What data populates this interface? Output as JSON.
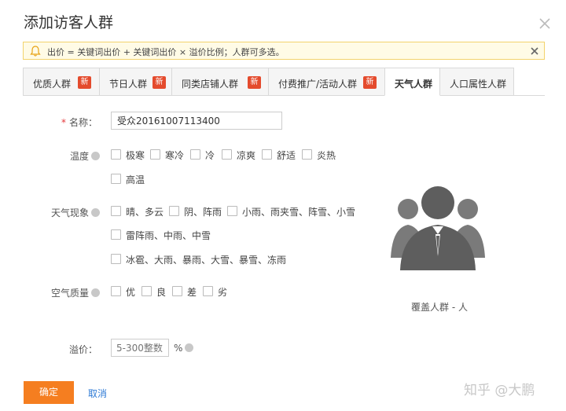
{
  "dialog": {
    "title": "添加访客人群"
  },
  "notice": {
    "text": "出价 = 关键词出价 + 关键词出价 × 溢价比例；人群可多选。"
  },
  "tabs": [
    {
      "label": "优质人群",
      "badge": "新",
      "active": false
    },
    {
      "label": "节日人群",
      "badge": "新",
      "active": false
    },
    {
      "label": "同类店铺人群",
      "badge": "新",
      "active": false
    },
    {
      "label": "付费推广/活动人群",
      "badge": "新",
      "active": false
    },
    {
      "label": "天气人群",
      "badge": "",
      "active": true
    },
    {
      "label": "人口属性人群",
      "badge": "",
      "active": false
    }
  ],
  "form": {
    "name": {
      "required_mark": "*",
      "label": "名称：",
      "value": "受众20161007113400"
    },
    "temperature": {
      "label": "温度",
      "options": [
        "极寒",
        "寒冷",
        "冷",
        "凉爽",
        "舒适",
        "炎热",
        "高温"
      ]
    },
    "weather": {
      "label": "天气现象",
      "options": [
        "晴、多云",
        "阴、阵雨",
        "小雨、雨夹雪、阵雪、小雪",
        "雷阵雨、中雨、中雪",
        "冰雹、大雨、暴雨、大雪、暴雪、冻雨"
      ]
    },
    "air_quality": {
      "label": "空气质量",
      "options": [
        "优",
        "良",
        "差",
        "劣"
      ]
    },
    "premium": {
      "label": "溢价：",
      "placeholder": "5-300整数",
      "unit": "%"
    }
  },
  "coverage": {
    "text": "覆盖人群 - 人"
  },
  "actions": {
    "confirm_label": "确定",
    "cancel_label": "取消"
  },
  "watermark": "知乎 @大鹏",
  "colors": {
    "primary_button": "#f57e20",
    "link": "#2f7bd6",
    "badge": "#e44b2d",
    "notice_bg": "#fffbe6",
    "avatar": "#606060"
  }
}
